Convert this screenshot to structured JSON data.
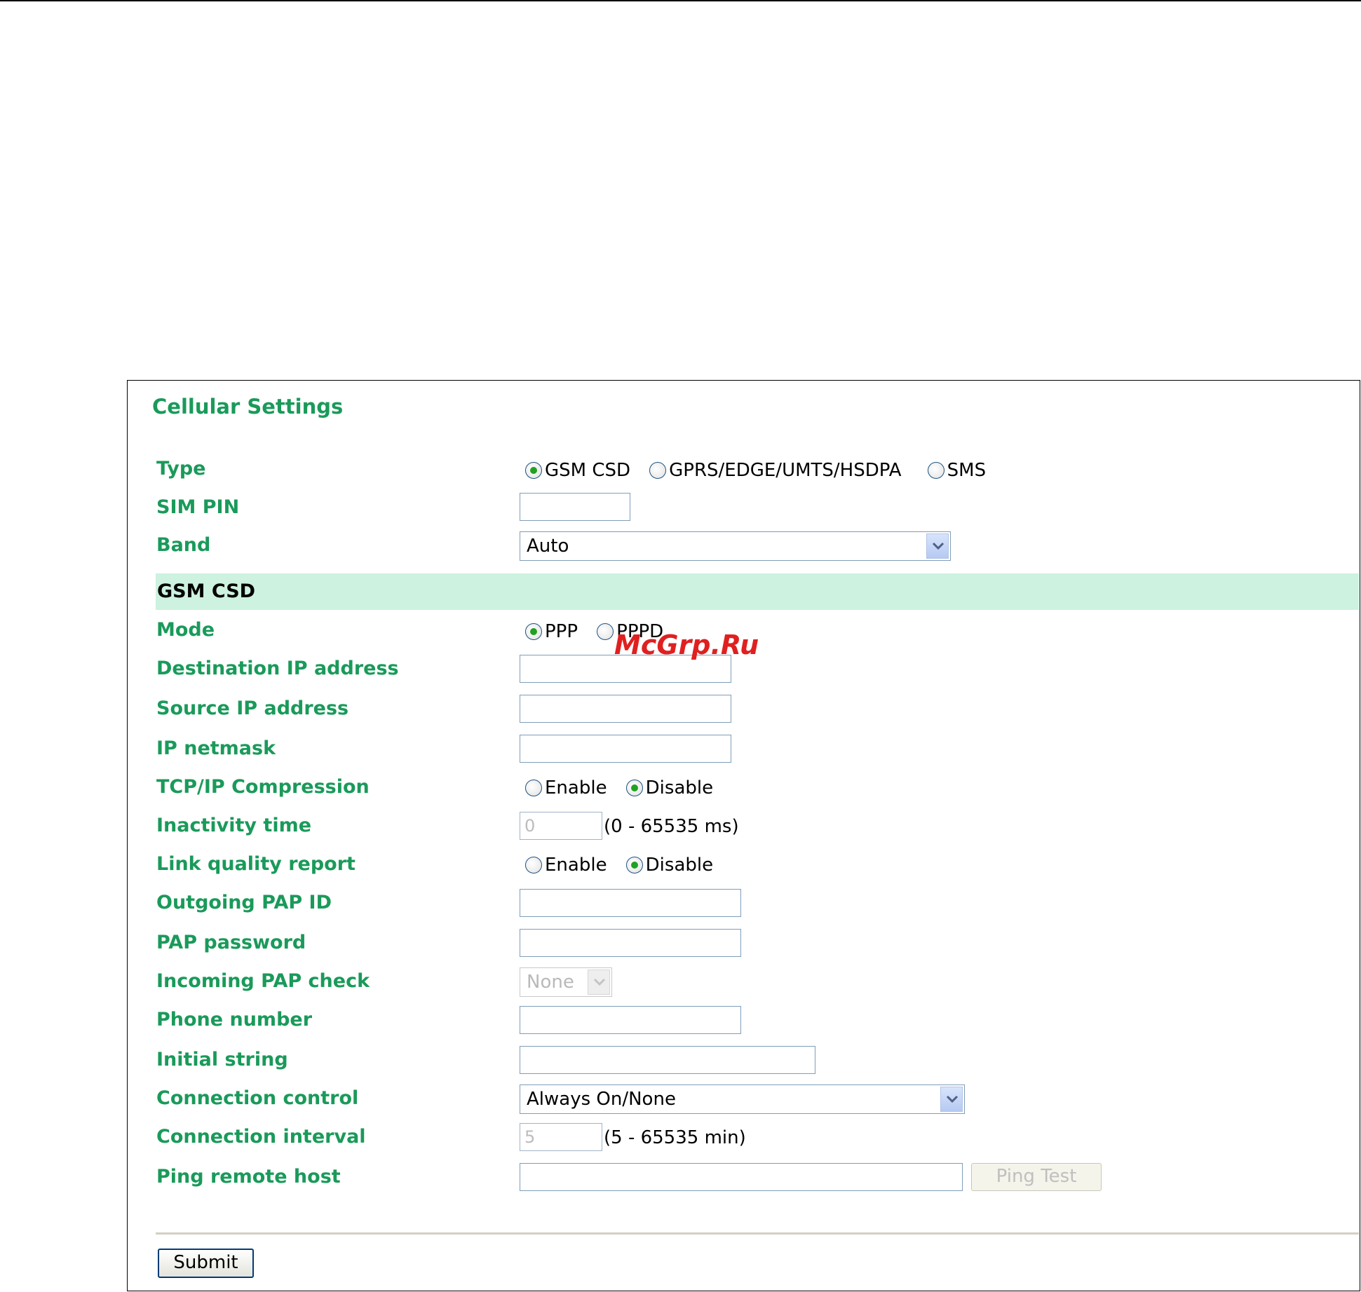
{
  "panel": {
    "title": "Cellular Settings"
  },
  "rows": {
    "type": {
      "label": "Type",
      "options": [
        "GSM CSD",
        "GPRS/EDGE/UMTS/HSDPA",
        "SMS"
      ],
      "selected": "GSM CSD"
    },
    "sim_pin": {
      "label": "SIM PIN",
      "value": ""
    },
    "band": {
      "label": "Band",
      "value": "Auto"
    }
  },
  "section": {
    "title": "GSM CSD"
  },
  "gsm": {
    "mode": {
      "label": "Mode",
      "options": [
        "PPP",
        "PPPD"
      ],
      "selected": "PPP"
    },
    "dest_ip": {
      "label": "Destination IP address",
      "value": ""
    },
    "src_ip": {
      "label": "Source IP address",
      "value": ""
    },
    "netmask": {
      "label": "IP netmask",
      "value": ""
    },
    "tcp_compression": {
      "label": "TCP/IP Compression",
      "options": [
        "Enable",
        "Disable"
      ],
      "selected": "Disable"
    },
    "inactivity": {
      "label": "Inactivity time",
      "value": "0",
      "hint": "(0 - 65535 ms)"
    },
    "link_quality": {
      "label": "Link quality report",
      "options": [
        "Enable",
        "Disable"
      ],
      "selected": "Disable"
    },
    "pap_id": {
      "label": "Outgoing PAP ID",
      "value": ""
    },
    "pap_password": {
      "label": "PAP password",
      "value": ""
    },
    "pap_check": {
      "label": "Incoming PAP check",
      "value": "None"
    },
    "phone": {
      "label": "Phone number",
      "value": ""
    },
    "init_string": {
      "label": "Initial string",
      "value": ""
    },
    "conn_control": {
      "label": "Connection control",
      "value": "Always On/None"
    },
    "conn_interval": {
      "label": "Connection interval",
      "value": "5",
      "hint": "(5 - 65535 min)"
    },
    "ping_host": {
      "label": "Ping remote host",
      "value": "",
      "button": "Ping Test"
    }
  },
  "actions": {
    "submit": "Submit"
  },
  "watermark": "McGrp.Ru",
  "colors": {
    "label": "#1a9a5a",
    "section_bg": "#cdf2df",
    "radio_dot": "#21a121"
  }
}
